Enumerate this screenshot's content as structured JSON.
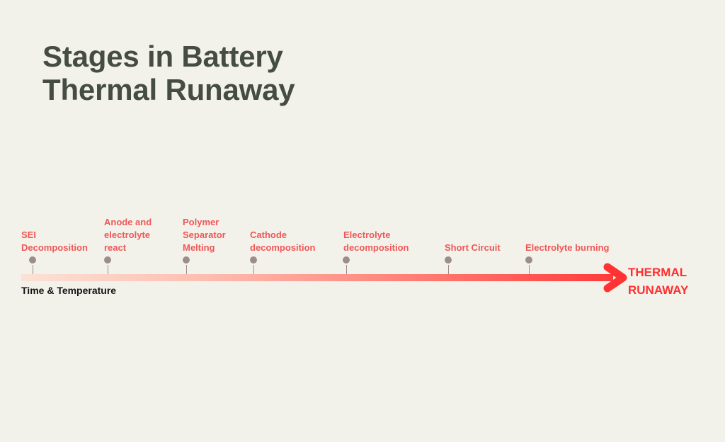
{
  "title": {
    "line1": "Stages in Battery",
    "line2": "Thermal Runaway"
  },
  "axis": {
    "label": "Time & Temperature",
    "end_label_line1": "THERMAL",
    "end_label_line2": "RUNAWAY"
  },
  "stages": [
    {
      "lines": [
        "SEI",
        "Decomposition"
      ]
    },
    {
      "lines": [
        "Anode and",
        "electrolyte",
        "react"
      ]
    },
    {
      "lines": [
        "Polymer",
        "Separator",
        "Melting"
      ]
    },
    {
      "lines": [
        "Cathode",
        "decomposition"
      ]
    },
    {
      "lines": [
        "Electrolyte",
        "decomposition"
      ]
    },
    {
      "lines": [
        "Short Circuit"
      ]
    },
    {
      "lines": [
        "Electrolyte burning"
      ]
    }
  ],
  "colors": {
    "title": "#454d41",
    "stage_label": "#f15656",
    "marker": "#9c8c8c",
    "arrow_end": "#ff3b3b"
  }
}
